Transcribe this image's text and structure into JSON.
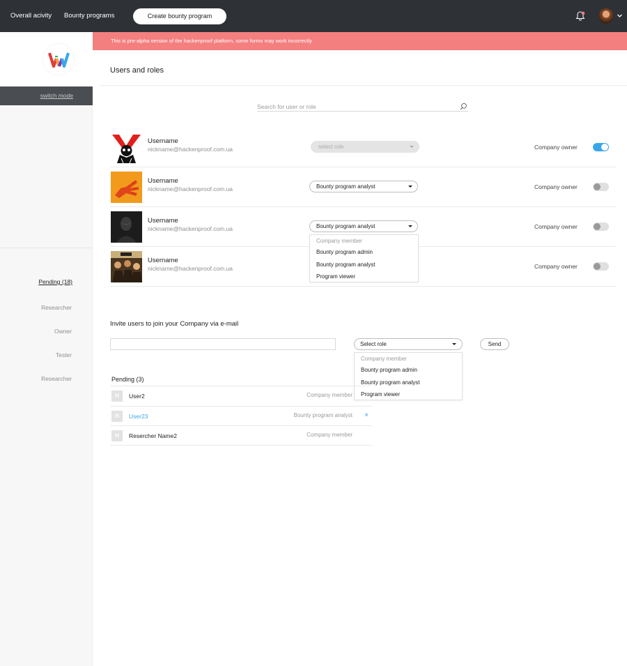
{
  "topbar": {
    "nav": [
      "Overall acivity",
      "Bounty programs"
    ],
    "create_button": "Create bounty program",
    "icons": [
      "bell-icon",
      "avatar",
      "chevron-down-icon"
    ],
    "notification_color": "#f47f7f"
  },
  "sidebar": {
    "switch_mode": "switch mode",
    "items": [
      "Pending (18)",
      "Researcher",
      "Owner",
      "Tester",
      "Researcher"
    ]
  },
  "alert": {
    "text": "This is pre-alpha version of the hackenproof platform, some forms may work incorrectly",
    "color": "#f47f7f"
  },
  "page": {
    "title": "Users and roles",
    "search_placeholder": "Search for user or role"
  },
  "users": [
    {
      "username": "Username",
      "email": "nickname@hackenproof.com.ua",
      "role": "select role",
      "owner_label": "Company owner",
      "owner": true
    },
    {
      "username": "Username",
      "email": "nickname@hackenproof.com.ua",
      "role": "Bounty program analyst",
      "owner_label": "Company owner",
      "owner": false
    },
    {
      "username": "Username",
      "email": "nickname@hackenproof.com.ua",
      "role": "Bounty program analyst",
      "owner_label": "Company owner",
      "owner": false
    },
    {
      "username": "Username",
      "email": "nickname@hackenproof.com.ua",
      "role": "",
      "owner_label": "Company owner",
      "owner": false
    }
  ],
  "role_dropdown": {
    "options": [
      "Company member",
      "Bounty program admin",
      "Bounty program analyst",
      "Program viewer"
    ]
  },
  "invite": {
    "title": "Invite users to join your Company via e-mail",
    "email_value": "",
    "select_label": "Select role",
    "send_label": "Send",
    "options": [
      "Company member",
      "Bounty program admin",
      "Bounty program analyst",
      "Program viewer"
    ]
  },
  "pending": {
    "title": "Pending (3)",
    "rows": [
      {
        "badge": "H",
        "name": "User2",
        "role": "Company member"
      },
      {
        "badge": "H",
        "name": "User23",
        "role": "Bounty program analyst"
      },
      {
        "badge": "H",
        "name": "Resercher Name2",
        "role": "Company member"
      }
    ],
    "remove_icon": "×"
  },
  "colors": {
    "accent": "#3aa6ea",
    "topbar": "#2e3237",
    "alert": "#f47f7f"
  }
}
